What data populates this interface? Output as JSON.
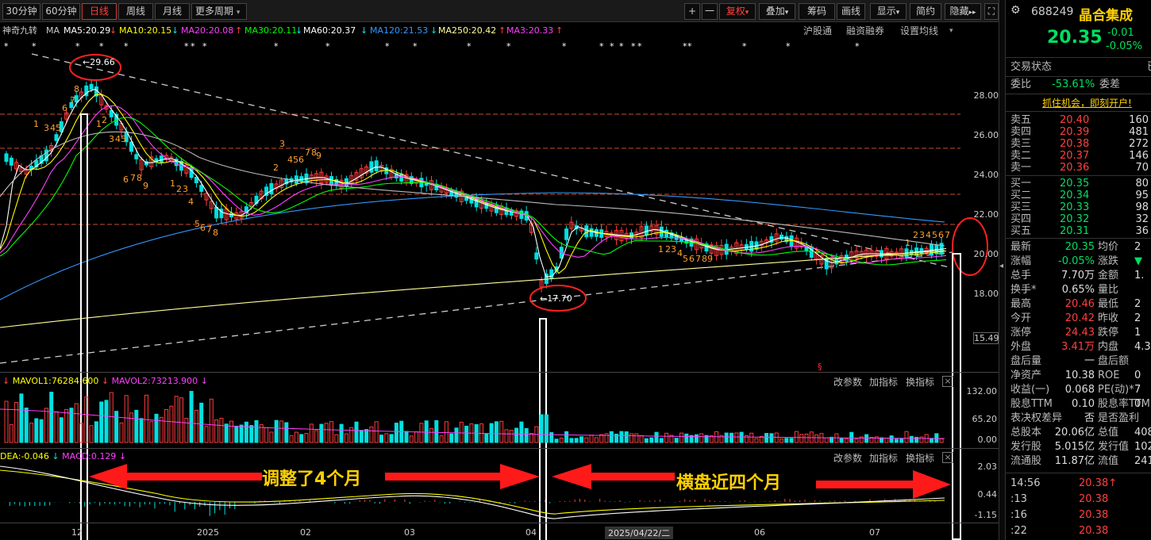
{
  "toolbar": {
    "periods": [
      "30分钟",
      "60分钟",
      "日线",
      "周线",
      "月线"
    ],
    "more_periods": "更多周期",
    "active_period": "日线",
    "plus": "+",
    "minus": "一",
    "fuquan": "复权",
    "overlay": "叠加",
    "chips": "筹码",
    "drawline": "画线",
    "display": "显示",
    "simple": "简约",
    "hide": "隐藏"
  },
  "ma_legend": {
    "indicator": "神奇九转",
    "ma": "MA",
    "ma5": "MA5:20.29",
    "ma10": "MA10:20.15",
    "ma20": "MA20:20.08",
    "ma30": "MA30:20.11",
    "ma60": "MA60:20.37",
    "ma120": "MA120:21.53",
    "ma250": "MA250:20.42",
    "ma3": "MA3:20.33",
    "hgt": "沪股通",
    "margin": "融资融券",
    "set_ma": "设置均线"
  },
  "colors": {
    "up": "#ff3b3b",
    "down": "#00e0e0",
    "ma5": "#ffffff",
    "ma10": "#ffff00",
    "ma20": "#ff40ff",
    "ma30": "#00ff00",
    "ma60": "#ffffff",
    "ma120": "#3399ff",
    "ma250": "#ffff99",
    "accent_red": "#ff2020",
    "annotation_yellow": "#ffd000"
  },
  "price_axis": {
    "ticks": [
      "28.00",
      "26.00",
      "24.00",
      "22.00",
      "20.00",
      "18.00"
    ],
    "low_label": "15.49"
  },
  "price_markers": {
    "high": "29.66",
    "low": "17.70"
  },
  "volume_panel": {
    "mavol1": "MAVOL1:76284.600",
    "mavol2": "MAVOL2:73213.900",
    "ticks": [
      "132.00",
      "65.20",
      "0.00"
    ]
  },
  "macd_panel": {
    "dea": "DEA:-0.046",
    "macd": "MACD:0.129",
    "ticks": [
      "2.03",
      "0.44",
      "-1.15"
    ]
  },
  "panel_buttons": {
    "change_param": "改参数",
    "add_indicator": "加指标",
    "swap_indicator": "换指标",
    "close": "×"
  },
  "x_axis": {
    "labels": [
      "12",
      "2025",
      "02",
      "03",
      "04",
      "06",
      "07"
    ],
    "cursor_date": "2025/04/22/二"
  },
  "annotations": {
    "adjust": "调整了4个月",
    "sideways": "横盘近四个月"
  },
  "quote": {
    "code": "688249",
    "name": "晶合集成",
    "price": "20.35",
    "change": "-0.01",
    "change_pct": "-0.05%",
    "trade_status_label": "交易状态",
    "trade_status_value": "已",
    "weibi_label": "委比",
    "weibi_value": "-53.61%",
    "weicha_label": "委差",
    "promo": "抓住机会，即刻开户!",
    "asks": [
      {
        "label": "卖五",
        "price": "20.40",
        "vol": "160"
      },
      {
        "label": "卖四",
        "price": "20.39",
        "vol": "481"
      },
      {
        "label": "卖三",
        "price": "20.38",
        "vol": "272"
      },
      {
        "label": "卖二",
        "price": "20.37",
        "vol": "146"
      },
      {
        "label": "卖一",
        "price": "20.36",
        "vol": "70"
      }
    ],
    "bids": [
      {
        "label": "买一",
        "price": "20.35",
        "vol": "80"
      },
      {
        "label": "买二",
        "price": "20.34",
        "vol": "95"
      },
      {
        "label": "买三",
        "price": "20.33",
        "vol": "98"
      },
      {
        "label": "买四",
        "price": "20.32",
        "vol": "32"
      },
      {
        "label": "买五",
        "price": "20.31",
        "vol": "36"
      }
    ],
    "stats": [
      {
        "l1": "最新",
        "v1": "20.35",
        "l2": "均价",
        "v2": "2"
      },
      {
        "l1": "涨幅",
        "v1": "-0.05%",
        "l2": "涨跌",
        "v2": "▼"
      },
      {
        "l1": "总手",
        "v1": "7.70万",
        "l2": "金额",
        "v2": "1."
      },
      {
        "l1": "换手*",
        "v1": "0.65%",
        "l2": "量比",
        "v2": ""
      },
      {
        "l1": "最高",
        "v1": "20.46",
        "l2": "最低",
        "v2": "2"
      },
      {
        "l1": "今开",
        "v1": "20.42",
        "l2": "昨收",
        "v2": "2"
      },
      {
        "l1": "涨停",
        "v1": "24.43",
        "l2": "跌停",
        "v2": "1"
      },
      {
        "l1": "外盘",
        "v1": "3.41万",
        "l2": "内盘",
        "v2": "4.3"
      },
      {
        "l1": "盘后量",
        "v1": "一",
        "l2": "盘后额",
        "v2": ""
      },
      {
        "l1": "净资产",
        "v1": "10.38",
        "l2": "ROE",
        "v2": "0"
      },
      {
        "l1": "收益(一)",
        "v1": "0.068",
        "l2": "PE(动)*",
        "v2": "7"
      },
      {
        "l1": "股息TTM",
        "v1": "0.10",
        "l2": "股息率TTM",
        "v2": "0."
      },
      {
        "l1": "表决权差异",
        "v1": "否",
        "l2": "是否盈利",
        "v2": ""
      },
      {
        "l1": "总股本",
        "v1": "20.06亿",
        "l2": "总值",
        "v2": "408"
      },
      {
        "l1": "发行股",
        "v1": "5.015亿",
        "l2": "发行值",
        "v2": "102"
      },
      {
        "l1": "流通股",
        "v1": "11.87亿",
        "l2": "流值",
        "v2": "241"
      }
    ],
    "ticks": [
      {
        "time": "14:56",
        "price": "20.38↑"
      },
      {
        "time": ":13",
        "price": "20.38"
      },
      {
        "time": ":16",
        "price": "20.38"
      },
      {
        "time": ":22",
        "price": "20.38"
      }
    ]
  }
}
